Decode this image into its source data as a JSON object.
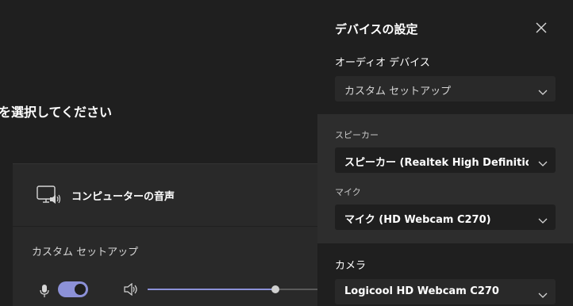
{
  "main": {
    "heading": "を選択してください",
    "audio_card": {
      "computer_audio_label": "コンピューターの音声",
      "custom_setup_label": "カスタム セットアップ",
      "mic_enabled": true,
      "volume_level": 0.75
    }
  },
  "panel": {
    "title": "デバイスの設定",
    "audio_device_label": "オーディオ デバイス",
    "audio_device_value": "カスタム セットアップ",
    "speaker_label": "スピーカー",
    "speaker_value": "スピーカー (Realtek High Definition...",
    "mic_label": "マイク",
    "mic_value": "マイク (HD Webcam C270)",
    "camera_label": "カメラ",
    "camera_value": "Logicool HD Webcam C270"
  },
  "colors": {
    "accent": "#8c91d8",
    "background": "#1f1f1f",
    "card": "#292929",
    "group": "#2d2d2d"
  },
  "icons": [
    "monitor-speaker-icon",
    "microphone-icon",
    "speaker-volume-icon",
    "close-icon",
    "chevron-down-icon"
  ]
}
